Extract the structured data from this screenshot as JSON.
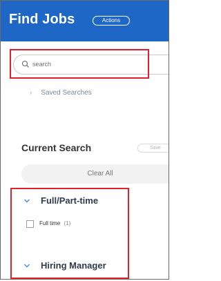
{
  "header": {
    "title": "Find Jobs",
    "actions_label": "Actions",
    "bg_color": "#1f67c6"
  },
  "search": {
    "placeholder": "search",
    "icon": "search-icon"
  },
  "saved_searches": {
    "label": "Saved Searches",
    "icon": "chevron-right-icon"
  },
  "current_search": {
    "title": "Current Search",
    "save_label": "Save",
    "clear_all_label": "Clear All"
  },
  "filters": [
    {
      "title": "Full/Part-time",
      "expanded": true,
      "options": [
        {
          "label": "Full time",
          "count": "(1)",
          "checked": false
        }
      ]
    },
    {
      "title": "Hiring Manager",
      "expanded": true
    }
  ],
  "colors": {
    "highlight": "#e0202a",
    "accent": "#1f67c6"
  }
}
